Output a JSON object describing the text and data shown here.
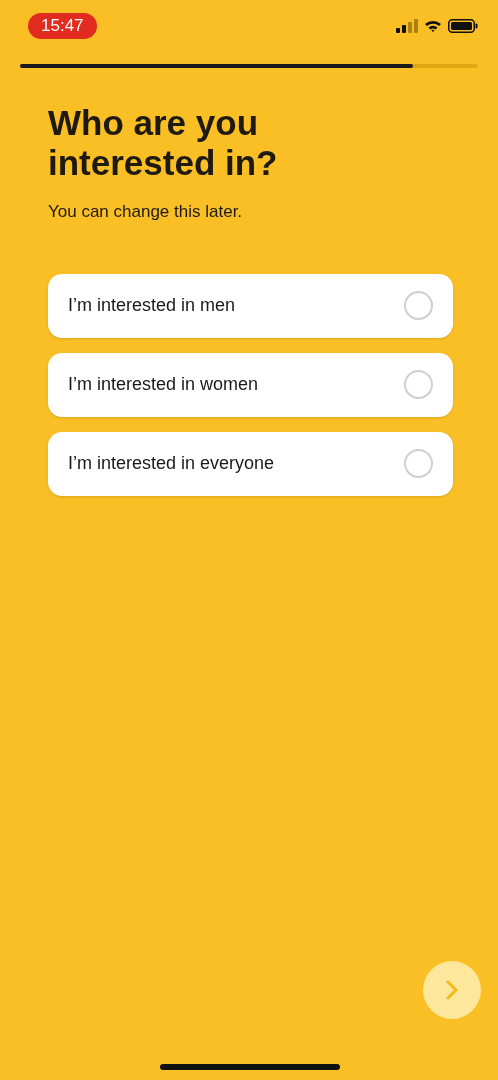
{
  "status_bar": {
    "time": "15:47"
  },
  "progress": {
    "level": 0.857
  },
  "title": "Who are you interested in?",
  "subtitle": "You can change this later.",
  "options": [
    {
      "label": "I’m interested in men",
      "selected": false
    },
    {
      "label": "I’m interested in women",
      "selected": false
    },
    {
      "label": "I’m interested in everyone",
      "selected": false
    }
  ],
  "next_button": {
    "disabled": true
  }
}
